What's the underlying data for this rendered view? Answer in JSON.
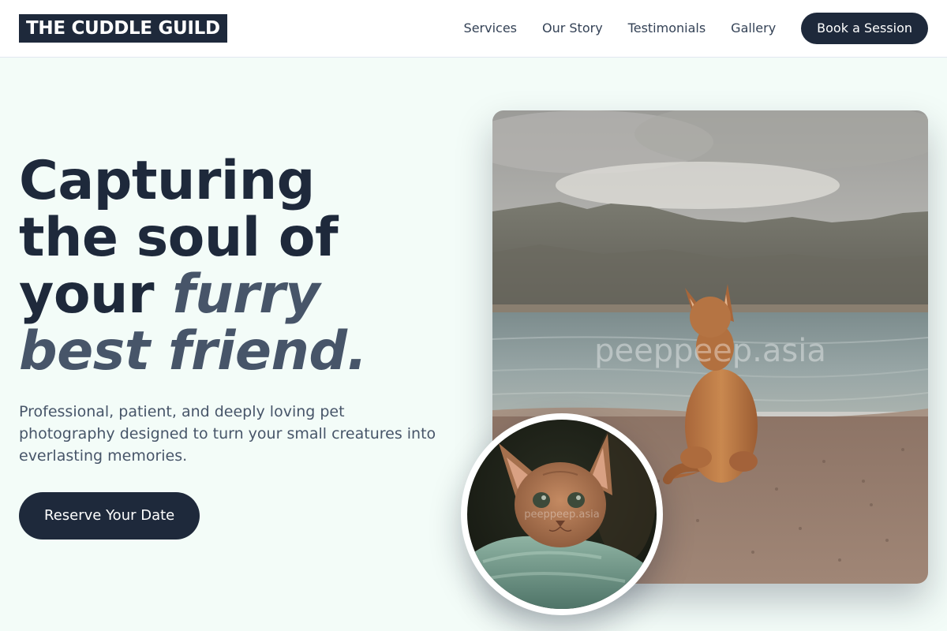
{
  "header": {
    "logo": "THE CUDDLE GUILD",
    "nav": [
      "Services",
      "Our Story",
      "Testimonials",
      "Gallery"
    ],
    "cta": "Book a Session"
  },
  "hero": {
    "title_line1": "Capturing",
    "title_line2": "the soul of",
    "title_line3_plain": "your ",
    "title_line3_accent": "furry",
    "title_line4_accent": "best friend.",
    "subtitle": "Professional, patient, and deeply loving pet photography designed to turn your small creatures into everlasting memories.",
    "button": "Reserve Your Date"
  },
  "images": {
    "main_watermark": "peeppeep.asia",
    "round_watermark": "peeppeep.asia"
  },
  "colors": {
    "brand_dark": "#1e293b",
    "accent_text": "#475569",
    "page_background": "#f3fcf8"
  }
}
